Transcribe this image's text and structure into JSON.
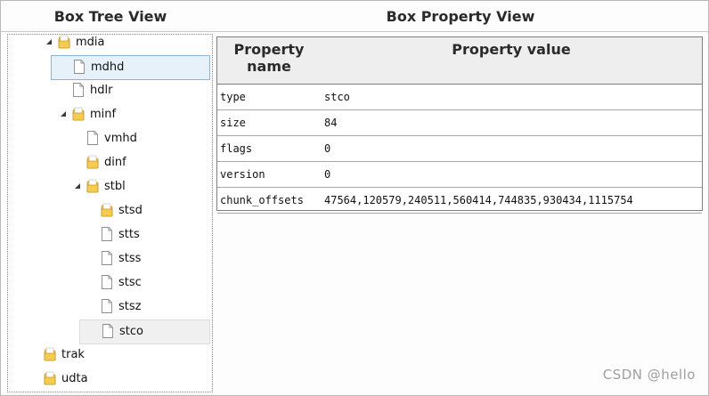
{
  "headers": {
    "tree": "Box Tree View",
    "properties": "Box Property View"
  },
  "tree": [
    {
      "label": "mdia",
      "kind": "folder",
      "state": "expanded",
      "depth": 1
    },
    {
      "label": "mdhd",
      "kind": "file",
      "state": "leaf",
      "depth": 2,
      "selected": true
    },
    {
      "label": "hdlr",
      "kind": "file",
      "state": "leaf",
      "depth": 2
    },
    {
      "label": "minf",
      "kind": "folder",
      "state": "expanded",
      "depth": 2
    },
    {
      "label": "vmhd",
      "kind": "file",
      "state": "leaf",
      "depth": 3
    },
    {
      "label": "dinf",
      "kind": "folder",
      "state": "collapsed",
      "depth": 3
    },
    {
      "label": "stbl",
      "kind": "folder",
      "state": "expanded",
      "depth": 3
    },
    {
      "label": "stsd",
      "kind": "folder",
      "state": "collapsed",
      "depth": 4
    },
    {
      "label": "stts",
      "kind": "file",
      "state": "leaf",
      "depth": 4
    },
    {
      "label": "stss",
      "kind": "file",
      "state": "leaf",
      "depth": 4
    },
    {
      "label": "stsc",
      "kind": "file",
      "state": "leaf",
      "depth": 4
    },
    {
      "label": "stsz",
      "kind": "file",
      "state": "leaf",
      "depth": 4
    },
    {
      "label": "stco",
      "kind": "file",
      "state": "leaf",
      "depth": 4,
      "hovered": true
    },
    {
      "label": "trak",
      "kind": "folder",
      "state": "collapsed",
      "depth": 0
    },
    {
      "label": "udta",
      "kind": "folder",
      "state": "collapsed",
      "depth": 0
    }
  ],
  "property_table": {
    "columns": [
      "Property name",
      "Property value"
    ],
    "rows": [
      {
        "name": "type",
        "value": "stco"
      },
      {
        "name": "size",
        "value": "84"
      },
      {
        "name": "flags",
        "value": "0"
      },
      {
        "name": "version",
        "value": "0"
      },
      {
        "name": "chunk_offsets",
        "value": "47564,120579,240511,560414,744835,930434,1115754"
      }
    ]
  },
  "watermark": "CSDN @hello",
  "colors": {
    "folder": "#f2c33a",
    "selected_bg": "#e6f1fa",
    "selected_border": "#8ab4d8",
    "header_bg": "#eeeeee"
  },
  "icons": {
    "folder": "folder-icon",
    "file": "file-icon",
    "expanded": "expanded-arrow-icon",
    "collapsed": "collapsed-arrow-icon"
  }
}
